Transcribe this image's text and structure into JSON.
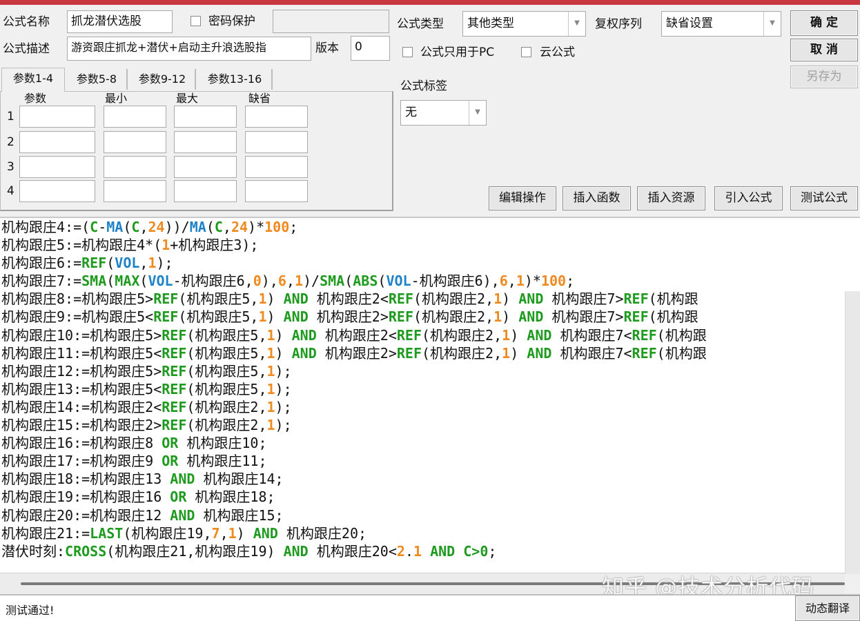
{
  "form": {
    "name_label": "公式名称",
    "name_value": "抓龙潜伏选股",
    "password_label": "密码保护",
    "password_value": "",
    "desc_label": "公式描述",
    "desc_value": "游资跟庄抓龙+潜伏+启动主升浪选股指",
    "version_label": "版本",
    "version_value": "0",
    "type_label": "公式类型",
    "type_value": "其他类型",
    "rights_label": "复权序列",
    "rights_value": "缺省设置",
    "pc_only_label": "公式只用于PC",
    "cloud_label": "云公式",
    "tag_label": "公式标签",
    "tag_value": "无"
  },
  "buttons": {
    "ok": "确  定",
    "cancel": "取  消",
    "save_as": "另存为",
    "edit_ops": "编辑操作",
    "insert_func": "插入函数",
    "insert_res": "插入资源",
    "import_formula": "引入公式",
    "test_formula": "测试公式",
    "dynamic_translate": "动态翻译"
  },
  "tabs": [
    "参数1-4",
    "参数5-8",
    "参数9-12",
    "参数13-16"
  ],
  "params": {
    "headers": [
      "参数",
      "最小",
      "最大",
      "缺省"
    ],
    "rows": [
      "1",
      "2",
      "3",
      "4"
    ]
  },
  "code_lines": [
    [
      [
        "t",
        "机构跟庄4:=("
      ],
      [
        "g",
        "C"
      ],
      [
        "t",
        "-"
      ],
      [
        "b",
        "MA"
      ],
      [
        "t",
        "("
      ],
      [
        "g",
        "C"
      ],
      [
        "t",
        ","
      ],
      [
        "o",
        "24"
      ],
      [
        "t",
        "))/"
      ],
      [
        "b",
        "MA"
      ],
      [
        "t",
        "("
      ],
      [
        "g",
        "C"
      ],
      [
        "t",
        ","
      ],
      [
        "o",
        "24"
      ],
      [
        "t",
        ")*"
      ],
      [
        "o",
        "100"
      ],
      [
        "t",
        ";"
      ]
    ],
    [
      [
        "t",
        "机构跟庄5:=机构跟庄4*("
      ],
      [
        "o",
        "1"
      ],
      [
        "t",
        "+机构跟庄3);"
      ]
    ],
    [
      [
        "t",
        "机构跟庄6:="
      ],
      [
        "g",
        "REF"
      ],
      [
        "t",
        "("
      ],
      [
        "b",
        "VOL"
      ],
      [
        "t",
        ","
      ],
      [
        "o",
        "1"
      ],
      [
        "t",
        ");"
      ]
    ],
    [
      [
        "t",
        "机构跟庄7:="
      ],
      [
        "g",
        "SMA"
      ],
      [
        "t",
        "("
      ],
      [
        "g",
        "MAX"
      ],
      [
        "t",
        "("
      ],
      [
        "b",
        "VOL"
      ],
      [
        "t",
        "-机构跟庄6,"
      ],
      [
        "o",
        "0"
      ],
      [
        "t",
        "),"
      ],
      [
        "o",
        "6"
      ],
      [
        "t",
        ","
      ],
      [
        "o",
        "1"
      ],
      [
        "t",
        ")/"
      ],
      [
        "g",
        "SMA"
      ],
      [
        "t",
        "("
      ],
      [
        "g",
        "ABS"
      ],
      [
        "t",
        "("
      ],
      [
        "b",
        "VOL"
      ],
      [
        "t",
        "-机构跟庄6),"
      ],
      [
        "o",
        "6"
      ],
      [
        "t",
        ","
      ],
      [
        "o",
        "1"
      ],
      [
        "t",
        ")*"
      ],
      [
        "o",
        "100"
      ],
      [
        "t",
        ";"
      ]
    ],
    [
      [
        "t",
        "机构跟庄8:=机构跟庄5>"
      ],
      [
        "g",
        "REF"
      ],
      [
        "t",
        "(机构跟庄5,"
      ],
      [
        "o",
        "1"
      ],
      [
        "t",
        ") "
      ],
      [
        "g",
        "AND"
      ],
      [
        "t",
        " 机构跟庄2<"
      ],
      [
        "g",
        "REF"
      ],
      [
        "t",
        "(机构跟庄2,"
      ],
      [
        "o",
        "1"
      ],
      [
        "t",
        ") "
      ],
      [
        "g",
        "AND"
      ],
      [
        "t",
        " 机构跟庄7>"
      ],
      [
        "g",
        "REF"
      ],
      [
        "t",
        "(机构跟"
      ]
    ],
    [
      [
        "t",
        "机构跟庄9:=机构跟庄5<"
      ],
      [
        "g",
        "REF"
      ],
      [
        "t",
        "(机构跟庄5,"
      ],
      [
        "o",
        "1"
      ],
      [
        "t",
        ") "
      ],
      [
        "g",
        "AND"
      ],
      [
        "t",
        " 机构跟庄2>"
      ],
      [
        "g",
        "REF"
      ],
      [
        "t",
        "(机构跟庄2,"
      ],
      [
        "o",
        "1"
      ],
      [
        "t",
        ") "
      ],
      [
        "g",
        "AND"
      ],
      [
        "t",
        " 机构跟庄7>"
      ],
      [
        "g",
        "REF"
      ],
      [
        "t",
        "(机构跟"
      ]
    ],
    [
      [
        "t",
        "机构跟庄10:=机构跟庄5>"
      ],
      [
        "g",
        "REF"
      ],
      [
        "t",
        "(机构跟庄5,"
      ],
      [
        "o",
        "1"
      ],
      [
        "t",
        ") "
      ],
      [
        "g",
        "AND"
      ],
      [
        "t",
        " 机构跟庄2<"
      ],
      [
        "g",
        "REF"
      ],
      [
        "t",
        "(机构跟庄2,"
      ],
      [
        "o",
        "1"
      ],
      [
        "t",
        ") "
      ],
      [
        "g",
        "AND"
      ],
      [
        "t",
        " 机构跟庄7<"
      ],
      [
        "g",
        "REF"
      ],
      [
        "t",
        "(机构跟"
      ]
    ],
    [
      [
        "t",
        "机构跟庄11:=机构跟庄5<"
      ],
      [
        "g",
        "REF"
      ],
      [
        "t",
        "(机构跟庄5,"
      ],
      [
        "o",
        "1"
      ],
      [
        "t",
        ") "
      ],
      [
        "g",
        "AND"
      ],
      [
        "t",
        " 机构跟庄2>"
      ],
      [
        "g",
        "REF"
      ],
      [
        "t",
        "(机构跟庄2,"
      ],
      [
        "o",
        "1"
      ],
      [
        "t",
        ") "
      ],
      [
        "g",
        "AND"
      ],
      [
        "t",
        " 机构跟庄7<"
      ],
      [
        "g",
        "REF"
      ],
      [
        "t",
        "(机构跟"
      ]
    ],
    [
      [
        "t",
        "机构跟庄12:=机构跟庄5>"
      ],
      [
        "g",
        "REF"
      ],
      [
        "t",
        "(机构跟庄5,"
      ],
      [
        "o",
        "1"
      ],
      [
        "t",
        ");"
      ]
    ],
    [
      [
        "t",
        "机构跟庄13:=机构跟庄5<"
      ],
      [
        "g",
        "REF"
      ],
      [
        "t",
        "(机构跟庄5,"
      ],
      [
        "o",
        "1"
      ],
      [
        "t",
        ");"
      ]
    ],
    [
      [
        "t",
        "机构跟庄14:=机构跟庄2<"
      ],
      [
        "g",
        "REF"
      ],
      [
        "t",
        "(机构跟庄2,"
      ],
      [
        "o",
        "1"
      ],
      [
        "t",
        ");"
      ]
    ],
    [
      [
        "t",
        "机构跟庄15:=机构跟庄2>"
      ],
      [
        "g",
        "REF"
      ],
      [
        "t",
        "(机构跟庄2,"
      ],
      [
        "o",
        "1"
      ],
      [
        "t",
        ");"
      ]
    ],
    [
      [
        "t",
        "机构跟庄16:=机构跟庄8 "
      ],
      [
        "g",
        "OR"
      ],
      [
        "t",
        " 机构跟庄10;"
      ]
    ],
    [
      [
        "t",
        "机构跟庄17:=机构跟庄9 "
      ],
      [
        "g",
        "OR"
      ],
      [
        "t",
        " 机构跟庄11;"
      ]
    ],
    [
      [
        "t",
        "机构跟庄18:=机构跟庄13 "
      ],
      [
        "g",
        "AND"
      ],
      [
        "t",
        " 机构跟庄14;"
      ]
    ],
    [
      [
        "t",
        "机构跟庄19:=机构跟庄16 "
      ],
      [
        "g",
        "OR"
      ],
      [
        "t",
        " 机构跟庄18;"
      ]
    ],
    [
      [
        "t",
        "机构跟庄20:=机构跟庄12 "
      ],
      [
        "g",
        "AND"
      ],
      [
        "t",
        " 机构跟庄15;"
      ]
    ],
    [
      [
        "t",
        "机构跟庄21:="
      ],
      [
        "g",
        "LAST"
      ],
      [
        "t",
        "(机构跟庄19,"
      ],
      [
        "o",
        "7"
      ],
      [
        "t",
        ","
      ],
      [
        "o",
        "1"
      ],
      [
        "t",
        ") "
      ],
      [
        "g",
        "AND"
      ],
      [
        "t",
        " 机构跟庄20;"
      ]
    ],
    [
      [
        "t",
        "潜伏时刻:"
      ],
      [
        "g",
        "CROSS"
      ],
      [
        "t",
        "(机构跟庄21,机构跟庄19) "
      ],
      [
        "g",
        "AND"
      ],
      [
        "t",
        " 机构跟庄20<"
      ],
      [
        "o",
        "2"
      ],
      [
        "t",
        "."
      ],
      [
        "o",
        "1"
      ],
      [
        "t",
        " "
      ],
      [
        "g",
        "AND"
      ],
      [
        "t",
        " "
      ],
      [
        "g",
        "C>0"
      ],
      [
        "t",
        ";"
      ]
    ]
  ],
  "status": {
    "message": "测试通过!"
  },
  "watermark": "知乎 @技术分析代码",
  "colors": {
    "title_bar": "#c8373f",
    "function": "#1e9a1e",
    "variable": "#1e82c8",
    "number": "#f0891e"
  }
}
